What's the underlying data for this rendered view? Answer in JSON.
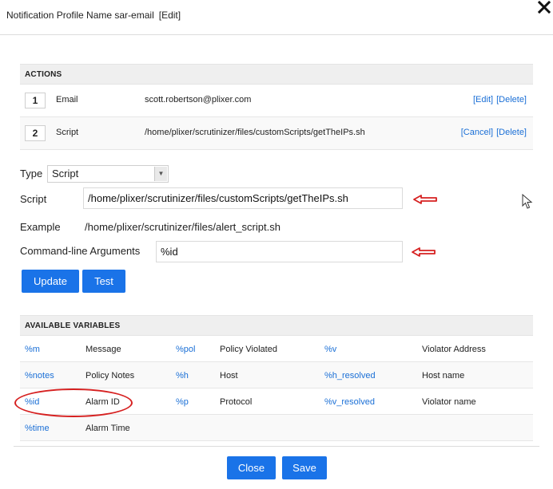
{
  "header": {
    "title": "Notification Profile Name sar-email",
    "edit_label": "[Edit]"
  },
  "actions": {
    "heading": "ACTIONS",
    "rows": [
      {
        "num": "1",
        "type": "Email",
        "value": "scott.robertson@plixer.com",
        "link1": "[Edit]",
        "link2": "[Delete]"
      },
      {
        "num": "2",
        "type": "Script",
        "value": "/home/plixer/scrutinizer/files/customScripts/getTheIPs.sh",
        "link1": "[Cancel]",
        "link2": "[Delete]"
      }
    ]
  },
  "form": {
    "type_label": "Type",
    "type_value": "Script",
    "script_label": "Script",
    "script_value": "/home/plixer/scrutinizer/files/customScripts/getTheIPs.sh",
    "example_label": "Example",
    "example_value": "/home/plixer/scrutinizer/files/alert_script.sh",
    "args_label": "Command-line Arguments",
    "args_value": "%id",
    "update_label": "Update",
    "test_label": "Test"
  },
  "variables": {
    "heading": "AVAILABLE VARIABLES",
    "rows": [
      [
        "%m",
        "Message",
        "%pol",
        "Policy Violated",
        "%v",
        "Violator Address"
      ],
      [
        "%notes",
        "Policy Notes",
        "%h",
        "Host",
        "%h_resolved",
        "Host name"
      ],
      [
        "%id",
        "Alarm ID",
        "%p",
        "Protocol",
        "%v_resolved",
        "Violator name"
      ],
      [
        "%time",
        "Alarm Time",
        "",
        "",
        "",
        ""
      ]
    ]
  },
  "footer": {
    "close_label": "Close",
    "save_label": "Save"
  },
  "colors": {
    "accent": "#1a73e8",
    "link": "#1a6fd6",
    "annotation": "#d62020"
  }
}
